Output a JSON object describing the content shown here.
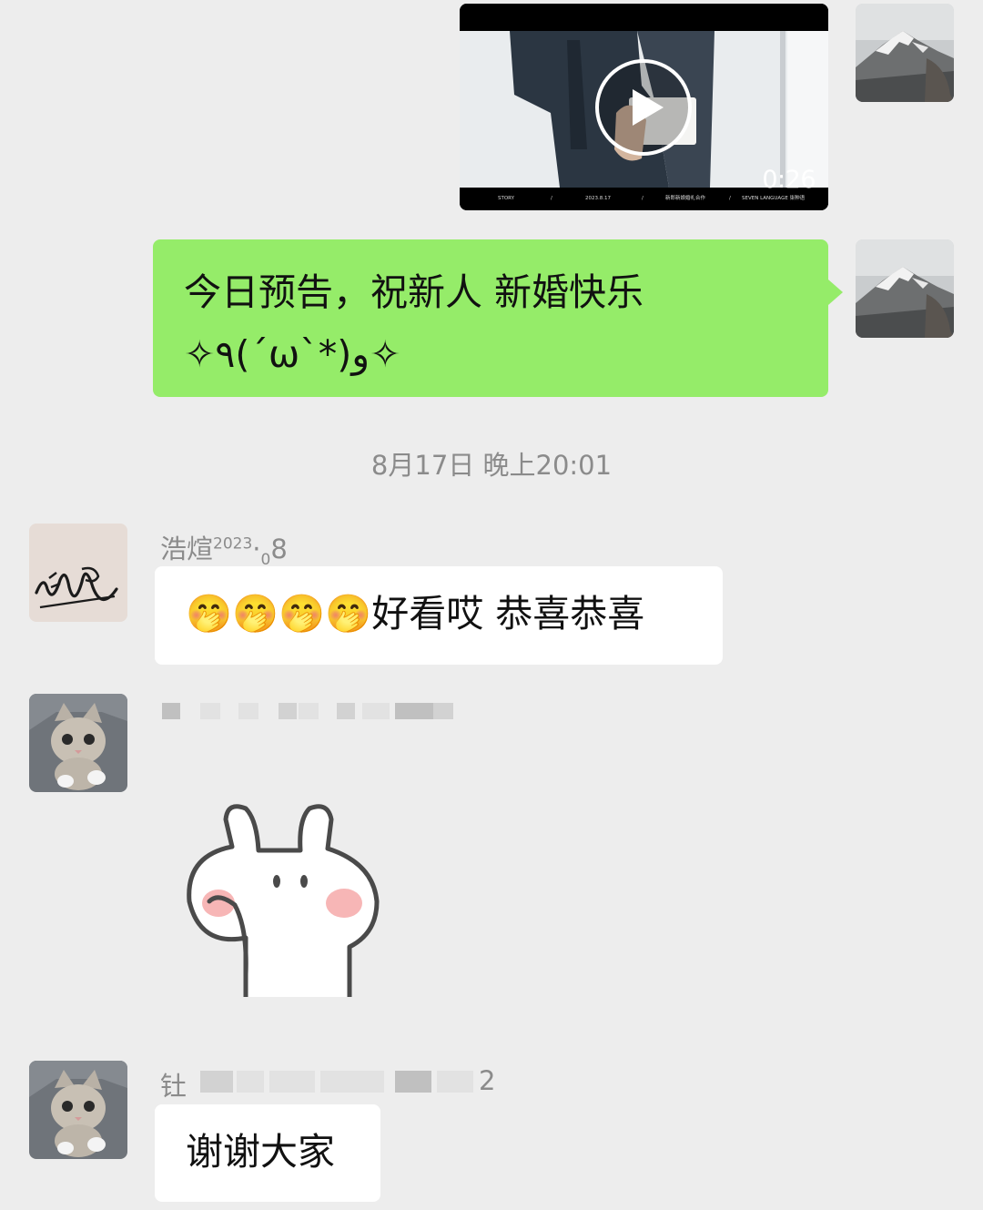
{
  "video_message": {
    "duration": "0:26",
    "footer_texts": [
      "STORY",
      "2023.8.17",
      "新郎新娘婚礼合作",
      "SEVEN LANGUAGE 柒种语"
    ]
  },
  "messages": [
    {
      "type": "text",
      "direction": "outgoing",
      "line1": "今日预告，祝新人 新婚快乐",
      "line2": "✧٩(ˊωˋ*)و✧"
    }
  ],
  "timestamp": "8月17日 晚上20:01",
  "incoming": [
    {
      "sender_name": "浩煊",
      "sender_suffix_sup": "2023",
      "sender_suffix_dot": "·",
      "sender_suffix_sub": "0",
      "sender_suffix_tail": "8",
      "emoji": "🤭🤭🤭🤭",
      "text": "好看哎  恭喜恭喜"
    },
    {
      "sender_name": "",
      "sticker": "rabbit-sticker"
    },
    {
      "sender_first_char": "钍",
      "sender_last_char": "2",
      "text": "谢谢大家"
    }
  ],
  "colors": {
    "background": "#ededed",
    "outgoing_bubble": "#95ec69",
    "incoming_bubble": "#ffffff",
    "meta_text": "#8b8b8b"
  }
}
